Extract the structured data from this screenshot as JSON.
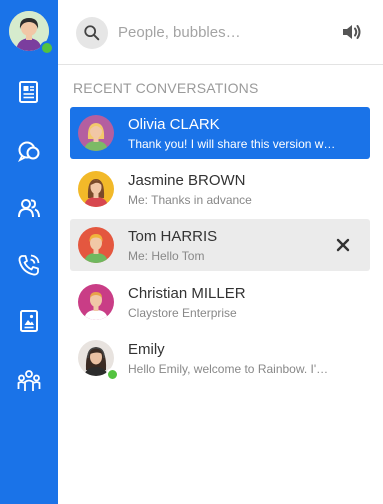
{
  "app": {
    "accent_color": "#1a73e8",
    "presence_color": "#53c33f"
  },
  "rail": {
    "items": [
      {
        "icon": "news-icon"
      },
      {
        "icon": "bubbles-icon"
      },
      {
        "icon": "contacts-icon"
      },
      {
        "icon": "phone-icon"
      },
      {
        "icon": "files-icon"
      },
      {
        "icon": "company-icon"
      }
    ]
  },
  "search": {
    "placeholder": "People, bubbles…",
    "value": ""
  },
  "recent": {
    "title": "RECENT CONVERSATIONS",
    "conversations": [
      {
        "name": "Olivia CLARK",
        "snippet": "Thank you! I will share this version w…",
        "state": "active",
        "avatar_color": "#b45fa0"
      },
      {
        "name": "Jasmine BROWN",
        "snippet": "Me: Thanks in advance",
        "state": "normal",
        "avatar_color": "#f2b929"
      },
      {
        "name": "Tom HARRIS",
        "snippet": "Me: Hello Tom",
        "state": "hover",
        "avatar_color": "#e4573f"
      },
      {
        "name": "Christian MILLER",
        "snippet": "Claystore Enterprise",
        "state": "normal",
        "avatar_color": "#c93d86"
      },
      {
        "name": "Emily",
        "snippet": "Hello Emily, welcome to Rainbow. I'…",
        "state": "normal",
        "avatar_color": "#e8e3df",
        "online": true
      }
    ]
  }
}
